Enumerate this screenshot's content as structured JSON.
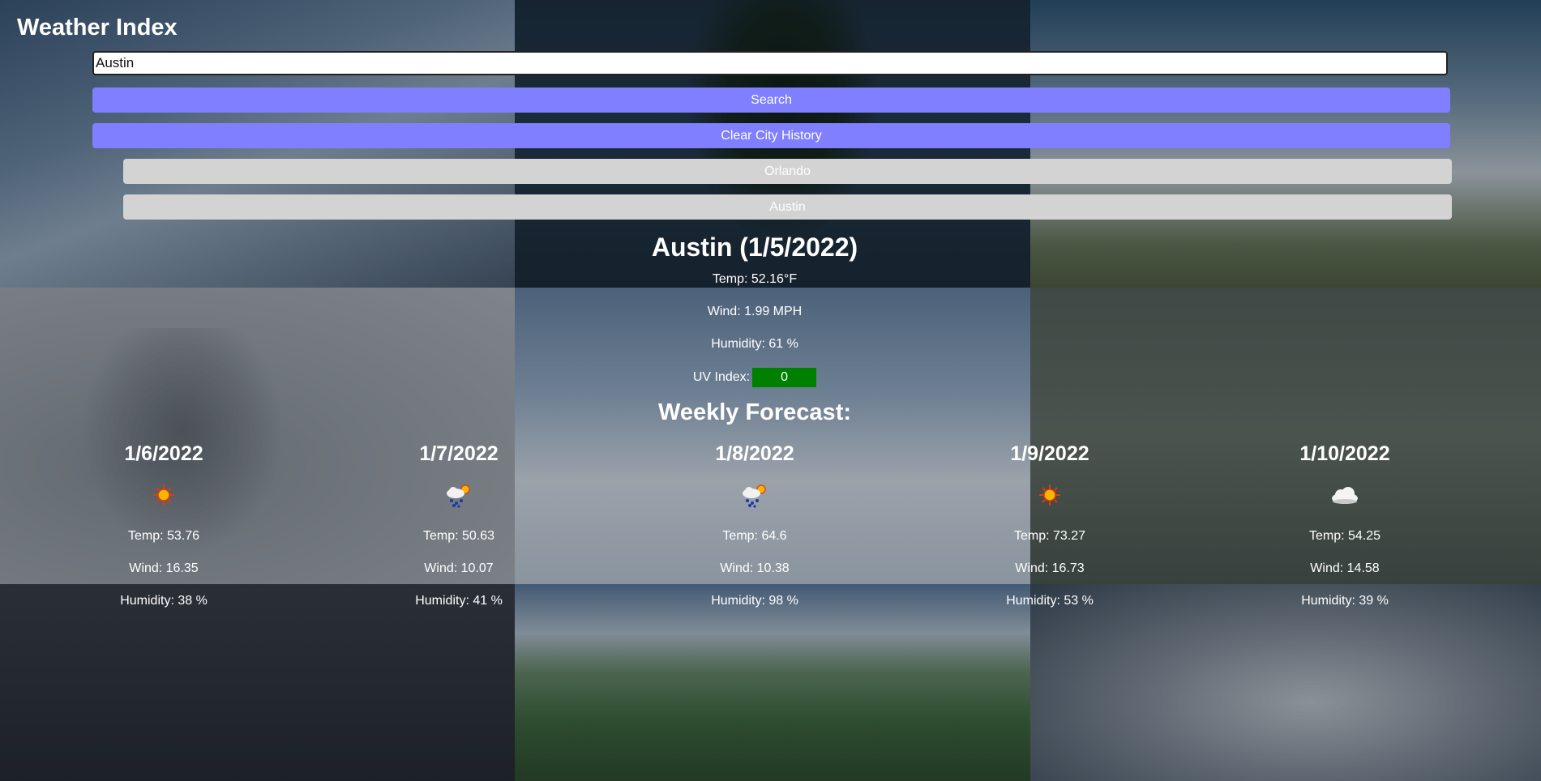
{
  "app": {
    "title": "Weather Index"
  },
  "search": {
    "value": "Austin",
    "button_label": "Search",
    "clear_label": "Clear City History"
  },
  "history": [
    {
      "label": "Orlando"
    },
    {
      "label": "Austin"
    }
  ],
  "current": {
    "title": "Austin (1/5/2022)",
    "temp": "Temp: 52.16°F",
    "wind": "Wind: 1.99 MPH",
    "humidity": "Humidity: 61 %",
    "uv_label": "UV Index:",
    "uv_value": "0",
    "uv_color": "#008000"
  },
  "forecast_heading": "Weekly Forecast:",
  "forecast": [
    {
      "date": "1/6/2022",
      "icon": "sunny-icon",
      "temp": "Temp: 53.76",
      "wind": "Wind: 16.35",
      "humidity": "Humidity: 38 %"
    },
    {
      "date": "1/7/2022",
      "icon": "rain-sun-icon",
      "temp": "Temp: 50.63",
      "wind": "Wind: 10.07",
      "humidity": "Humidity: 41 %"
    },
    {
      "date": "1/8/2022",
      "icon": "rain-sun-icon",
      "temp": "Temp: 64.6",
      "wind": "Wind: 10.38",
      "humidity": "Humidity: 98 %"
    },
    {
      "date": "1/9/2022",
      "icon": "sunny-icon",
      "temp": "Temp: 73.27",
      "wind": "Wind: 16.73",
      "humidity": "Humidity: 53 %"
    },
    {
      "date": "1/10/2022",
      "icon": "cloud-icon",
      "temp": "Temp: 54.25",
      "wind": "Wind: 14.58",
      "humidity": "Humidity: 39 %"
    }
  ],
  "colors": {
    "primary_button": "#7f7fff",
    "history_button": "#d3d3d3"
  }
}
